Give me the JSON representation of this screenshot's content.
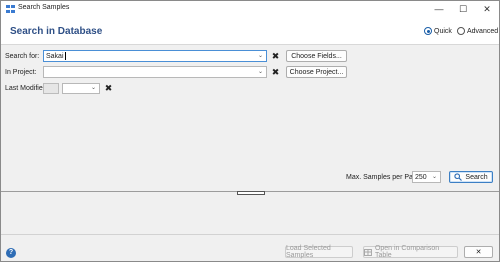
{
  "window": {
    "title": "Search Samples",
    "minimize_glyph": "—",
    "maximize_glyph": "☐",
    "close_glyph": "✕"
  },
  "header": {
    "title": "Search in Database",
    "mode_options": [
      {
        "label": "Quick",
        "selected": true
      },
      {
        "label": "Advanced",
        "selected": false
      }
    ]
  },
  "form": {
    "search_for": {
      "label": "Search for:",
      "value": "Sakai",
      "button": "Choose Fields..."
    },
    "in_project": {
      "label": "In Project:",
      "value": "",
      "button": "Choose Project..."
    },
    "last_modified": {
      "label": "Last Modified:",
      "value": ""
    }
  },
  "paging": {
    "label": "Max. Samples per Page:",
    "value": "250",
    "search_button": "Search"
  },
  "footer": {
    "load_button": "Load Selected Samples",
    "compare_button": "Open in Comparison Table"
  },
  "icons": {
    "clear": "✖",
    "chevron": "⌄",
    "help": "?"
  },
  "colors": {
    "header_title": "#2e4f86",
    "accent": "#1a5ea8"
  }
}
